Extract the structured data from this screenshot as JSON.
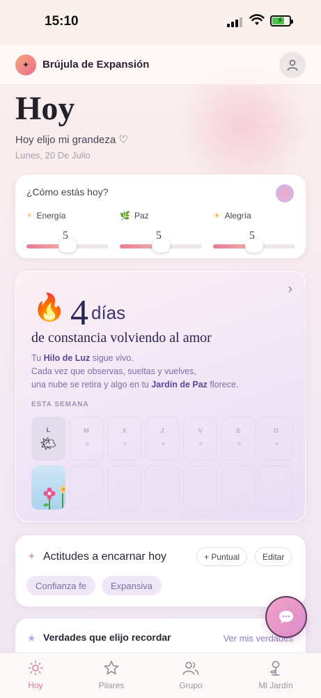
{
  "status_bar": {
    "time": "15:10"
  },
  "app": {
    "name": "Brújula de Expansión"
  },
  "header": {
    "title": "Hoy",
    "subtitle": "Hoy elijo mi grandeza ♡",
    "date": "Lunes, 20 De Julio"
  },
  "mood": {
    "question": "¿Cómo estás hoy?",
    "sliders": [
      {
        "label": "Energía",
        "icon": "lightning-icon",
        "value": 5,
        "max": 10
      },
      {
        "label": "Paz",
        "icon": "leaf-icon",
        "value": 5,
        "max": 10
      },
      {
        "label": "Alegría",
        "icon": "sun-icon",
        "value": 5,
        "max": 10
      }
    ]
  },
  "streak": {
    "count": "4",
    "unit": "días",
    "subtitle": "de constancia volviendo al amor",
    "line1_a": "Tu ",
    "line1_b": "Hilo de Luz",
    "line1_c": " sigue vivo.",
    "line2": "Cada vez que observas, sueltas y vuelves,",
    "line3_a": "una nube se retira y algo en tu ",
    "line3_b": "Jardín de Paz",
    "line3_c": " florece.",
    "week_label": "ESTA SEMANA",
    "days": [
      "L",
      "M",
      "X",
      "J",
      "V",
      "S",
      "D"
    ]
  },
  "actitudes": {
    "title": "Actitudes a encarnar hoy",
    "add_label": "+ Puntual",
    "edit_label": "Editar",
    "tags": [
      "Confianza fe",
      "Expansiva"
    ]
  },
  "verdades": {
    "title": "Verdades que elijo recordar",
    "link": "Ver mis verdades"
  },
  "nav": {
    "items": [
      {
        "label": "Hoy",
        "icon": "sun-icon",
        "active": true
      },
      {
        "label": "Pilares",
        "icon": "star-icon",
        "active": false
      },
      {
        "label": "Grupo",
        "icon": "group-icon",
        "active": false
      },
      {
        "label": "Mi Jardín",
        "icon": "plant-icon",
        "active": false
      }
    ]
  },
  "colors": {
    "accent": "#e2789a",
    "brand_purple": "#3b3470"
  }
}
